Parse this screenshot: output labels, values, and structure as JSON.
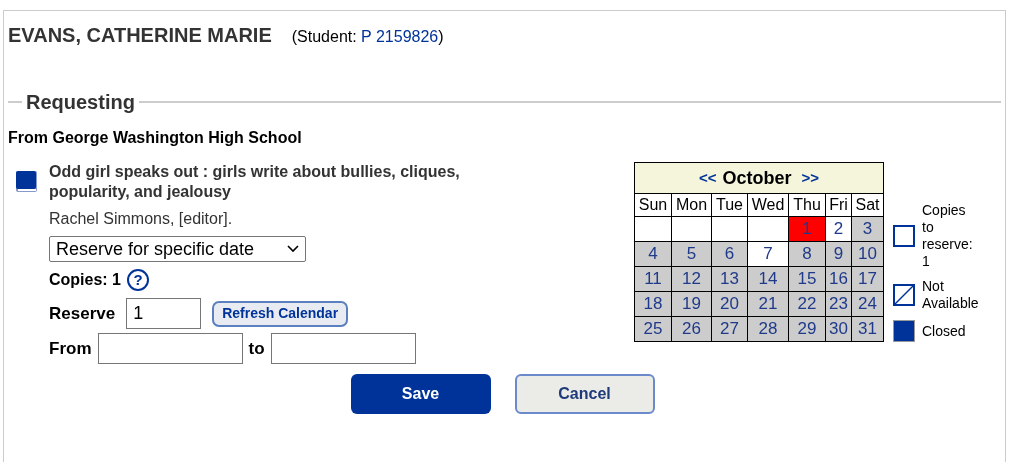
{
  "student": {
    "name": "EVANS, CATHERINE MARIE",
    "label_open": "(Student: ",
    "id": "P 2159826",
    "label_close": ")"
  },
  "section": {
    "legend": "Requesting",
    "from": "From George Washington High School"
  },
  "item": {
    "title": "Odd girl speaks out : girls write about bullies, cliques, popularity, and jealousy",
    "author": "Rachel Simmons, [editor].",
    "reserve_type": "Reserve for specific date",
    "copies_label": "Copies: 1",
    "help": "?",
    "reserve_label": "Reserve",
    "reserve_value": "1",
    "refresh_button": "Refresh Calendar",
    "from_label": "From",
    "to_label": "to"
  },
  "calendar": {
    "prev": "<<",
    "month": "October",
    "next": ">>",
    "weekdays": [
      "Sun",
      "Mon",
      "Tue",
      "Wed",
      "Thu",
      "Fri",
      "Sat"
    ],
    "weeks": [
      [
        {
          "selected": false,
          "available": true
        },
        {
          "selected": false,
          "available": true
        },
        {
          "selected": false,
          "available": true
        },
        {
          "selected": false,
          "available": true
        },
        {
          "day": "1",
          "selected": true
        },
        {
          "day": "2",
          "selected": false,
          "available": true
        },
        {
          "day": "3",
          "selected": false,
          "available": false
        }
      ],
      [
        {
          "day": "4",
          "selected": false,
          "available": false
        },
        {
          "day": "5",
          "selected": false,
          "available": false
        },
        {
          "day": "6",
          "selected": false,
          "available": false
        },
        {
          "day": "7",
          "selected": false,
          "available": true
        },
        {
          "day": "8",
          "selected": false,
          "available": false
        },
        {
          "day": "9",
          "selected": false,
          "available": false
        },
        {
          "day": "10",
          "selected": false,
          "available": false
        }
      ],
      [
        {
          "day": "11",
          "selected": false,
          "available": false
        },
        {
          "day": "12",
          "selected": false,
          "available": false
        },
        {
          "day": "13",
          "selected": false,
          "available": false
        },
        {
          "day": "14",
          "selected": false,
          "available": false
        },
        {
          "day": "15",
          "selected": false,
          "available": false
        },
        {
          "day": "16",
          "selected": false,
          "available": false
        },
        {
          "day": "17",
          "selected": false,
          "available": false
        }
      ],
      [
        {
          "day": "18",
          "selected": false,
          "available": false
        },
        {
          "day": "19",
          "selected": false,
          "available": false
        },
        {
          "day": "20",
          "selected": false,
          "available": false
        },
        {
          "day": "21",
          "selected": false,
          "available": false
        },
        {
          "day": "22",
          "selected": false,
          "available": false
        },
        {
          "day": "23",
          "selected": false,
          "available": false
        },
        {
          "day": "24",
          "selected": false,
          "available": false
        }
      ],
      [
        {
          "day": "25",
          "selected": false,
          "available": false
        },
        {
          "day": "26",
          "selected": false,
          "available": false
        },
        {
          "day": "27",
          "selected": false,
          "available": false
        },
        {
          "day": "28",
          "selected": false,
          "available": false
        },
        {
          "day": "29",
          "selected": false,
          "available": false
        },
        {
          "day": "30",
          "selected": false,
          "available": false
        },
        {
          "day": "31",
          "selected": false,
          "available": false
        }
      ]
    ]
  },
  "legend": [
    {
      "kind": "open",
      "label": "Copies to reserve: 1"
    },
    {
      "kind": "not_available",
      "label": "Not Available"
    },
    {
      "kind": "closed",
      "label": "Closed"
    }
  ],
  "buttons": [
    {
      "kind": "primary",
      "label": "Save"
    },
    {
      "kind": "secondary",
      "label": "Cancel"
    }
  ]
}
